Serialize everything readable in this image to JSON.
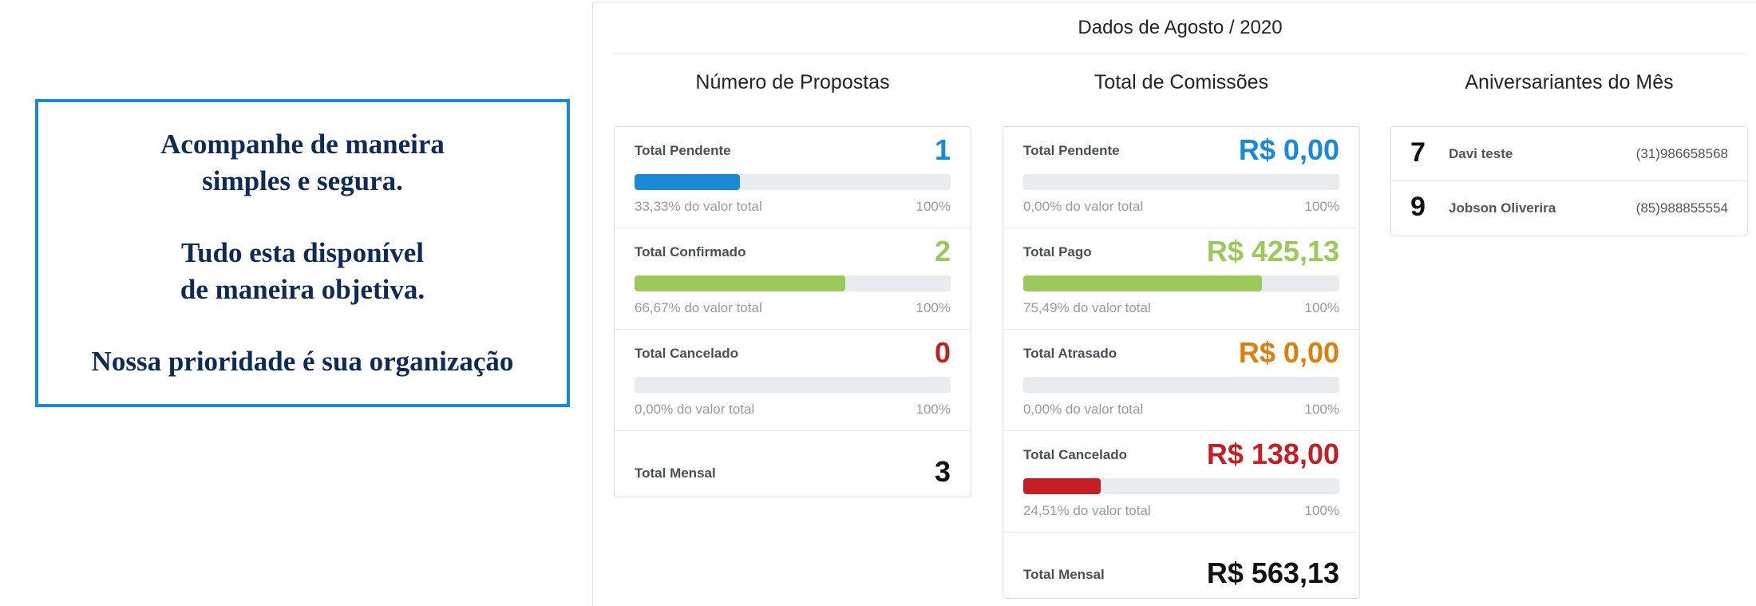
{
  "promo": {
    "lines": [
      "Acompanhe de maneira\nsimples e segura.",
      "Tudo esta disponível\nde maneira objetiva.",
      "Nossa prioridade é sua organização"
    ]
  },
  "header": {
    "title": "Dados de Agosto / 2020"
  },
  "colors": {
    "blue": "#1a8ad6",
    "green": "#9bc95a",
    "red": "#c41f24",
    "orange": "#d9800f"
  },
  "propostas": {
    "title": "Número de Propostas",
    "items": [
      {
        "label": "Total Pendente",
        "value": "1",
        "pct_text": "33,33% do valor total",
        "max_text": "100%",
        "fill_percent": 33.33
      },
      {
        "label": "Total Confirmado",
        "value": "2",
        "pct_text": "66,67% do valor total",
        "max_text": "100%",
        "fill_percent": 66.67
      },
      {
        "label": "Total Cancelado",
        "value": "0",
        "pct_text": "0,00% do valor total",
        "max_text": "100%",
        "fill_percent": 0
      }
    ],
    "total": {
      "label": "Total Mensal",
      "value": "3"
    }
  },
  "comissoes": {
    "title": "Total de Comissões",
    "items": [
      {
        "label": "Total Pendente",
        "value": "R$ 0,00",
        "pct_text": "0,00% do valor total",
        "max_text": "100%",
        "fill_percent": 0
      },
      {
        "label": "Total Pago",
        "value": "R$ 425,13",
        "pct_text": "75,49% do valor total",
        "max_text": "100%",
        "fill_percent": 75.49
      },
      {
        "label": "Total Atrasado",
        "value": "R$ 0,00",
        "pct_text": "0,00% do valor total",
        "max_text": "100%",
        "fill_percent": 0
      },
      {
        "label": "Total Cancelado",
        "value": "R$ 138,00",
        "pct_text": "24,51% do valor total",
        "max_text": "100%",
        "fill_percent": 24.51
      }
    ],
    "total": {
      "label": "Total Mensal",
      "value": "R$ 563,13"
    }
  },
  "aniversariantes": {
    "title": "Aniversariantes do Mês",
    "items": [
      {
        "day": "7",
        "name": "Davi teste",
        "phone": "(31)986658568"
      },
      {
        "day": "9",
        "name": "Jobson Oliverira",
        "phone": "(85)988855554"
      }
    ]
  }
}
